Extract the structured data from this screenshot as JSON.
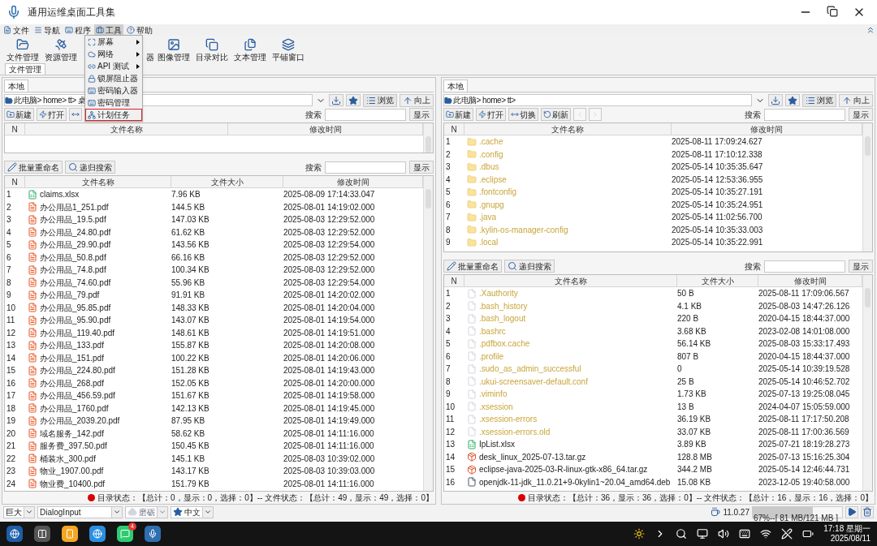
{
  "window": {
    "title": "通用运维桌面工具集"
  },
  "menu_bar": [
    {
      "label": "文件",
      "kind": "file",
      "selected": false
    },
    {
      "label": "导航",
      "kind": "nav",
      "selected": false
    },
    {
      "label": "程序",
      "kind": "program",
      "selected": false
    },
    {
      "label": "工具",
      "kind": "tools",
      "selected": true
    },
    {
      "label": "帮助",
      "kind": "help",
      "selected": false
    }
  ],
  "tools_menu": [
    {
      "label": "屏幕",
      "kind": "screen",
      "submenu": true,
      "highlighted": false
    },
    {
      "label": "网络",
      "kind": "network",
      "submenu": true,
      "highlighted": false
    },
    {
      "label": "API 测试",
      "kind": "api",
      "submenu": true,
      "highlighted": false
    },
    {
      "label": "锁屏阻止器",
      "kind": "lock",
      "submenu": false,
      "highlighted": false
    },
    {
      "label": "密码输入器",
      "kind": "keyboard",
      "submenu": false,
      "highlighted": false
    },
    {
      "label": "密码管理",
      "kind": "keyboard",
      "submenu": false,
      "highlighted": false
    },
    {
      "label": "计划任务",
      "kind": "tasks",
      "submenu": false,
      "highlighted": true
    }
  ],
  "toolbar": [
    {
      "label": "文件管理",
      "kind": "folder"
    },
    {
      "label": "资源管理",
      "kind": "satellite"
    },
    {
      "label": "器",
      "kind": "hidden"
    },
    {
      "label": "图像管理",
      "kind": "image"
    },
    {
      "label": "目录对比",
      "kind": "compare"
    },
    {
      "label": "文本管理",
      "kind": "text"
    },
    {
      "label": "平铺窗口",
      "kind": "tile"
    }
  ],
  "main_tabs": [
    {
      "label": "文件管理",
      "selected": true
    }
  ],
  "panels": [
    {
      "tab": "本地",
      "path": "此电脑> home> tt> 桌",
      "browse": "浏览",
      "up": "向上",
      "dir_buttons": [
        {
          "label": "新建",
          "kind": "new",
          "disabled": false
        },
        {
          "label": "打开",
          "kind": "open",
          "disabled": false
        },
        {
          "kind": "switch",
          "disabled": false
        }
      ],
      "search_label": "搜索",
      "show_button": "显示",
      "dir_table": {
        "columns": [
          "N",
          "文件名称",
          "修改时间"
        ]
      },
      "file_buttons": [
        {
          "label": "批量重命名",
          "kind": "rename"
        },
        {
          "label": "递归搜索",
          "kind": "search"
        }
      ],
      "file_search_label": "搜索",
      "file_show_button": "显示",
      "file_table": {
        "columns": [
          "N",
          "文件名称",
          "文件大小",
          "修改时间"
        ],
        "rows": [
          {
            "n": "1",
            "name": "claims.xlsx",
            "kind": "xlsx",
            "size": "7.96 KB",
            "time": "2025-08-09 17:14:33.047"
          },
          {
            "n": "2",
            "name": "办公用品1_251.pdf",
            "kind": "pdf",
            "size": "144.5 KB",
            "time": "2025-08-01 14:19:02.000"
          },
          {
            "n": "3",
            "name": "办公用品_19.5.pdf",
            "kind": "pdf",
            "size": "147.03 KB",
            "time": "2025-08-03 12:29:52.000"
          },
          {
            "n": "4",
            "name": "办公用品_24.80.pdf",
            "kind": "pdf",
            "size": "61.62 KB",
            "time": "2025-08-03 12:29:52.000"
          },
          {
            "n": "5",
            "name": "办公用品_29.90.pdf",
            "kind": "pdf",
            "size": "143.56 KB",
            "time": "2025-08-03 12:29:54.000"
          },
          {
            "n": "6",
            "name": "办公用品_50.8.pdf",
            "kind": "pdf",
            "size": "66.16 KB",
            "time": "2025-08-03 12:29:52.000"
          },
          {
            "n": "7",
            "name": "办公用品_74.8.pdf",
            "kind": "pdf",
            "size": "100.34 KB",
            "time": "2025-08-03 12:29:52.000"
          },
          {
            "n": "8",
            "name": "办公用品_74.60.pdf",
            "kind": "pdf",
            "size": "55.96 KB",
            "time": "2025-08-03 12:29:54.000"
          },
          {
            "n": "9",
            "name": "办公用品_79.pdf",
            "kind": "pdf",
            "size": "91.91 KB",
            "time": "2025-08-01 14:20:02.000"
          },
          {
            "n": "10",
            "name": "办公用品_95.85.pdf",
            "kind": "pdf",
            "size": "148.33 KB",
            "time": "2025-08-01 14:20:04.000"
          },
          {
            "n": "11",
            "name": "办公用品_95.90.pdf",
            "kind": "pdf",
            "size": "143.07 KB",
            "time": "2025-08-01 14:19:54.000"
          },
          {
            "n": "12",
            "name": "办公用品_119.40.pdf",
            "kind": "pdf",
            "size": "148.61 KB",
            "time": "2025-08-01 14:19:51.000"
          },
          {
            "n": "13",
            "name": "办公用品_133.pdf",
            "kind": "pdf",
            "size": "155.87 KB",
            "time": "2025-08-01 14:20:08.000"
          },
          {
            "n": "14",
            "name": "办公用品_151.pdf",
            "kind": "pdf",
            "size": "100.22 KB",
            "time": "2025-08-01 14:20:06.000"
          },
          {
            "n": "15",
            "name": "办公用品_224.80.pdf",
            "kind": "pdf",
            "size": "151.28 KB",
            "time": "2025-08-01 14:19:43.000"
          },
          {
            "n": "16",
            "name": "办公用品_268.pdf",
            "kind": "pdf",
            "size": "152.05 KB",
            "time": "2025-08-01 14:20:00.000"
          },
          {
            "n": "17",
            "name": "办公用品_456.59.pdf",
            "kind": "pdf",
            "size": "151.67 KB",
            "time": "2025-08-01 14:19:58.000"
          },
          {
            "n": "18",
            "name": "办公用品_1760.pdf",
            "kind": "pdf",
            "size": "142.13 KB",
            "time": "2025-08-01 14:19:45.000"
          },
          {
            "n": "19",
            "name": "办公用品_2039.20.pdf",
            "kind": "pdf",
            "size": "87.95 KB",
            "time": "2025-08-01 14:19:49.000"
          },
          {
            "n": "20",
            "name": "域名服务_142.pdf",
            "kind": "pdf",
            "size": "58.62 KB",
            "time": "2025-08-01 14:11:16.000"
          },
          {
            "n": "21",
            "name": "服务费_397.50.pdf",
            "kind": "pdf",
            "size": "150.45 KB",
            "time": "2025-08-01 14:11:16.000"
          },
          {
            "n": "22",
            "name": "桶装水_300.pdf",
            "kind": "pdf",
            "size": "145.1 KB",
            "time": "2025-08-03 10:39:02.000"
          },
          {
            "n": "23",
            "name": "物业_1907.00.pdf",
            "kind": "pdf",
            "size": "143.17 KB",
            "time": "2025-08-03 10:39:03.000"
          },
          {
            "n": "24",
            "name": "物业费_10400.pdf",
            "kind": "pdf",
            "size": "151.79 KB",
            "time": "2025-08-01 14:11:16.000"
          }
        ]
      },
      "status": "目录状态：【总计：0，显示：0，选择：0】-- 文件状态：【总计：49，显示：49，选择：0】"
    },
    {
      "tab": "本地",
      "path": "此电脑> home> tt>",
      "browse": "浏览",
      "up": "向上",
      "dir_buttons": [
        {
          "label": "新建",
          "kind": "new",
          "disabled": false
        },
        {
          "label": "打开",
          "kind": "open",
          "disabled": false
        },
        {
          "label": "切换",
          "kind": "switch",
          "disabled": false
        },
        {
          "label": "刷新",
          "kind": "refresh",
          "disabled": false
        },
        {
          "kind": "prev",
          "disabled": true
        },
        {
          "kind": "next",
          "disabled": true
        }
      ],
      "search_label": "搜索",
      "show_button": "显示",
      "dir_table": {
        "columns": [
          "N",
          "文件名称",
          "修改时间"
        ],
        "rows": [
          {
            "n": "1",
            "name": ".cache",
            "kind": "folder",
            "time": "2025-08-11 17:09:24.627"
          },
          {
            "n": "2",
            "name": ".config",
            "kind": "folder",
            "time": "2025-08-11 17:10:12.338"
          },
          {
            "n": "3",
            "name": ".dbus",
            "kind": "folder",
            "time": "2025-05-14 10:35:35.647"
          },
          {
            "n": "4",
            "name": ".eclipse",
            "kind": "folder",
            "time": "2025-05-14 12:53:36.955"
          },
          {
            "n": "5",
            "name": ".fontconfig",
            "kind": "folder",
            "time": "2025-05-14 10:35:27.191"
          },
          {
            "n": "6",
            "name": ".gnupg",
            "kind": "folder",
            "time": "2025-05-14 10:35:24.951"
          },
          {
            "n": "7",
            "name": ".java",
            "kind": "folder",
            "time": "2025-05-14 11:02:56.700"
          },
          {
            "n": "8",
            "name": ".kylin-os-manager-config",
            "kind": "folder",
            "time": "2025-05-14 10:35:33.003"
          },
          {
            "n": "9",
            "name": ".local",
            "kind": "folder",
            "time": "2025-05-14 10:35:22.991"
          }
        ]
      },
      "file_buttons": [
        {
          "label": "批量重命名",
          "kind": "rename"
        },
        {
          "label": "递归搜索",
          "kind": "search"
        }
      ],
      "file_search_label": "搜索",
      "file_show_button": "显示",
      "file_table": {
        "columns": [
          "N",
          "文件名称",
          "文件大小",
          "修改时间"
        ],
        "rows": [
          {
            "n": "1",
            "name": ".Xauthority",
            "kind": "hidden",
            "size": "50 B",
            "time": "2025-08-11 17:09:06.567"
          },
          {
            "n": "2",
            "name": ".bash_history",
            "kind": "hidden",
            "size": "4.1 KB",
            "time": "2025-08-03 14:47:26.126"
          },
          {
            "n": "3",
            "name": ".bash_logout",
            "kind": "hidden",
            "size": "220 B",
            "time": "2020-04-15 18:44:37.000"
          },
          {
            "n": "4",
            "name": ".bashrc",
            "kind": "hidden",
            "size": "3.68 KB",
            "time": "2023-02-08 14:01:08.000"
          },
          {
            "n": "5",
            "name": ".pdfbox.cache",
            "kind": "hidden",
            "size": "56.14 KB",
            "time": "2025-08-03 15:33:17.493"
          },
          {
            "n": "6",
            "name": ".profile",
            "kind": "hidden",
            "size": "807 B",
            "time": "2020-04-15 18:44:37.000"
          },
          {
            "n": "7",
            "name": ".sudo_as_admin_successful",
            "kind": "hidden",
            "size": "0",
            "time": "2025-05-14 10:39:19.528"
          },
          {
            "n": "8",
            "name": ".ukui-screensaver-default.conf",
            "kind": "hidden",
            "size": "25 B",
            "time": "2025-05-14 10:46:52.702"
          },
          {
            "n": "9",
            "name": ".viminfo",
            "kind": "hidden",
            "size": "1.73 KB",
            "time": "2025-07-13 19:25:08.045"
          },
          {
            "n": "10",
            "name": ".xsession",
            "kind": "hidden",
            "size": "13 B",
            "time": "2024-04-07 15:05:59.000"
          },
          {
            "n": "11",
            "name": ".xsession-errors",
            "kind": "hidden",
            "size": "36.19 KB",
            "time": "2025-08-11 17:17:50.208"
          },
          {
            "n": "12",
            "name": ".xsession-errors.old",
            "kind": "hidden",
            "size": "33.07 KB",
            "time": "2025-08-11 17:00:36.569"
          },
          {
            "n": "13",
            "name": "IpList.xlsx",
            "kind": "xlsx",
            "size": "3.89 KB",
            "time": "2025-07-21 18:19:28.273"
          },
          {
            "n": "14",
            "name": "desk_linux_2025-07-13.tar.gz",
            "kind": "archive",
            "size": "128.8 MB",
            "time": "2025-07-13 15:16:25.304"
          },
          {
            "n": "15",
            "name": "eclipse-java-2025-03-R-linux-gtk-x86_64.tar.gz",
            "kind": "archive",
            "size": "344.2 MB",
            "time": "2025-05-14 12:46:44.731"
          },
          {
            "n": "16",
            "name": "openjdk-11-jdk_11.0.21+9-0kylin1~20.04_amd64.deb",
            "kind": "file",
            "size": "15.08 KB",
            "time": "2023-12-05 19:40:58.000"
          }
        ]
      },
      "status": "目录状态：【总计：36，显示：36，选择：0】-- 文件状态：【总计：16，显示：16，选择：0】"
    }
  ],
  "bottom_bar": {
    "combos": [
      {
        "value": "巨大",
        "kind": "plain",
        "disabled": false
      },
      {
        "value": "DialogInput",
        "kind": "plain",
        "disabled": false
      },
      {
        "value": "磨砺",
        "kind": "spade",
        "disabled": true
      },
      {
        "value": "中文",
        "kind": "star",
        "disabled": false
      }
    ],
    "version": "11.0.27",
    "memory": {
      "text": "67%--[ 81 MB/121 MB ]",
      "level": 0.67
    }
  },
  "taskbar": {
    "apps": [
      {
        "kind": "logo"
      },
      {
        "kind": "files"
      },
      {
        "kind": "notes"
      },
      {
        "kind": "browser"
      },
      {
        "kind": "chat",
        "badge": "4"
      },
      {
        "kind": "app"
      }
    ],
    "time": "17:18 星期一",
    "date": "2025/08/11"
  }
}
